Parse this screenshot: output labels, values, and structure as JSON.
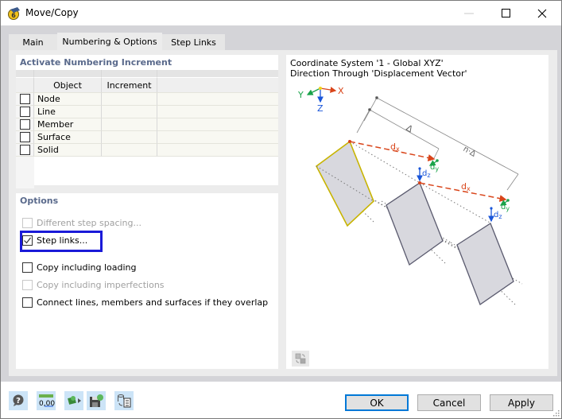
{
  "window": {
    "title": "Move/Copy",
    "controls": {
      "minimize": "minimize",
      "maximize": "maximize",
      "close": "close"
    }
  },
  "tabs": [
    {
      "label": "Main",
      "active": false
    },
    {
      "label": "Numbering & Options",
      "active": true
    },
    {
      "label": "Step Links",
      "active": false
    }
  ],
  "increment_group": {
    "title": "Activate Numbering Increment",
    "columns": [
      "Object",
      "Increment"
    ],
    "rows": [
      {
        "object": "Node",
        "increment": "",
        "checked": false
      },
      {
        "object": "Line",
        "increment": "",
        "checked": false
      },
      {
        "object": "Member",
        "increment": "",
        "checked": false
      },
      {
        "object": "Surface",
        "increment": "",
        "checked": false
      },
      {
        "object": "Solid",
        "increment": "",
        "checked": false
      }
    ]
  },
  "options_group": {
    "title": "Options",
    "items": [
      {
        "label": "Different step spacing...",
        "checked": false,
        "enabled": false
      },
      {
        "label": "Step links...",
        "checked": true,
        "enabled": true,
        "highlighted": true
      },
      {
        "label": "Copy including loading",
        "checked": false,
        "enabled": true
      },
      {
        "label": "Copy including imperfections",
        "checked": false,
        "enabled": false
      },
      {
        "label": "Connect lines, members and surfaces if they overlap",
        "checked": false,
        "enabled": true
      }
    ]
  },
  "preview": {
    "line1": "Coordinate System '1 - Global XYZ'",
    "line2": "Direction Through 'Displacement Vector'",
    "axes": {
      "x": "X",
      "y": "Y",
      "z": "Z"
    },
    "labels": {
      "delta": "Δ",
      "n_delta": "n·Δ",
      "dx": "d",
      "dx_sub": "x",
      "dy": "d",
      "dy_sub": "y",
      "dz": "d",
      "dz_sub": "z"
    },
    "colors": {
      "x": "#d9451a",
      "y": "#1aa34a",
      "z": "#1a56d9",
      "origin": "#f2d21a",
      "selected_outline": "#c8b400",
      "shape_fill": "#d8d8de",
      "shape_stroke": "#5a5a6e"
    }
  },
  "footer": {
    "icons": [
      "help-icon",
      "units-icon",
      "import-icon",
      "save-settings-icon",
      "defaults-icon"
    ],
    "units_text": "0,00",
    "ok_label": "OK",
    "cancel_label": "Cancel",
    "apply_label": "Apply"
  }
}
